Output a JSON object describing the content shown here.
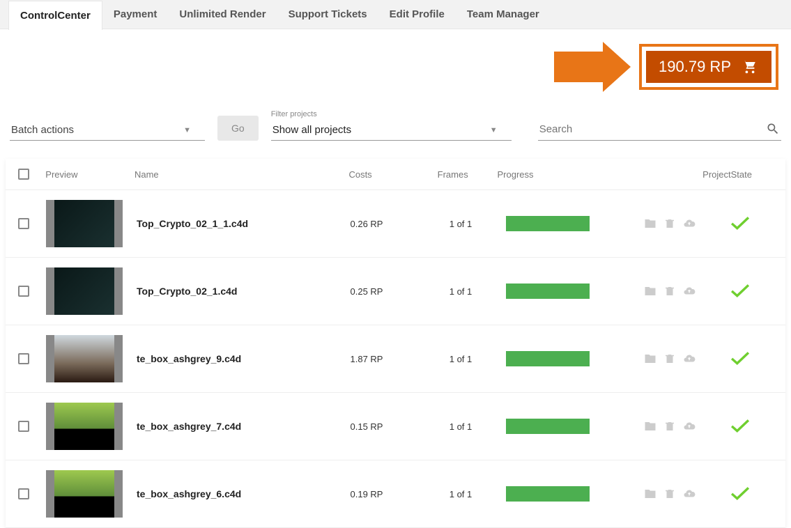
{
  "tabs": [
    "ControlCenter",
    "Payment",
    "Unlimited Render",
    "Support Tickets",
    "Edit Profile",
    "Team Manager"
  ],
  "activeTab": 0,
  "rpBalance": "190.79 RP",
  "batch": {
    "label": "Batch actions",
    "goLabel": "Go"
  },
  "filter": {
    "caption": "Filter projects",
    "value": "Show all projects"
  },
  "search": {
    "placeholder": "Search"
  },
  "headers": {
    "preview": "Preview",
    "name": "Name",
    "costs": "Costs",
    "frames": "Frames",
    "progress": "Progress",
    "state": "ProjectState"
  },
  "rows": [
    {
      "name": "Top_Crypto_02_1_1.c4d",
      "cost": "0.26 RP",
      "frames": "1 of 1",
      "thumb": "dark"
    },
    {
      "name": "Top_Crypto_02_1.c4d",
      "cost": "0.25 RP",
      "frames": "1 of 1",
      "thumb": "dark"
    },
    {
      "name": "te_box_ashgrey_9.c4d",
      "cost": "1.87 RP",
      "frames": "1 of 1",
      "thumb": "room"
    },
    {
      "name": "te_box_ashgrey_7.c4d",
      "cost": "0.15 RP",
      "frames": "1 of 1",
      "thumb": "green"
    },
    {
      "name": "te_box_ashgrey_6.c4d",
      "cost": "0.19 RP",
      "frames": "1 of 1",
      "thumb": "green"
    }
  ]
}
